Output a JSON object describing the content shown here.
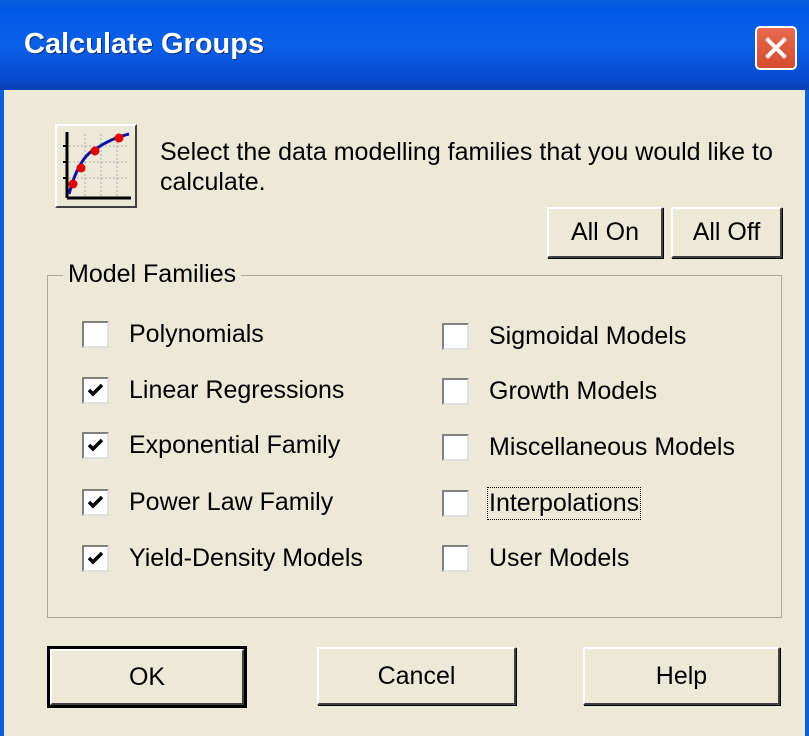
{
  "window": {
    "title": "Calculate Groups"
  },
  "description": "Select the data modelling families that you would like to calculate.",
  "toolbar": {
    "all_on_label": "All On",
    "all_off_label": "All Off"
  },
  "group": {
    "legend": "Model Families"
  },
  "left_checkboxes": [
    {
      "label": "Polynomials",
      "checked": false
    },
    {
      "label": "Linear Regressions",
      "checked": true
    },
    {
      "label": "Exponential Family",
      "checked": true
    },
    {
      "label": "Power Law Family",
      "checked": true
    },
    {
      "label": "Yield-Density Models",
      "checked": true
    }
  ],
  "right_checkboxes": [
    {
      "label": "Sigmoidal Models",
      "checked": false
    },
    {
      "label": "Growth Models",
      "checked": false
    },
    {
      "label": "Miscellaneous Models",
      "checked": false
    },
    {
      "label": "Interpolations",
      "checked": false
    },
    {
      "label": "User Models",
      "checked": false
    }
  ],
  "footer": {
    "ok_label": "OK",
    "cancel_label": "Cancel",
    "help_label": "Help"
  }
}
